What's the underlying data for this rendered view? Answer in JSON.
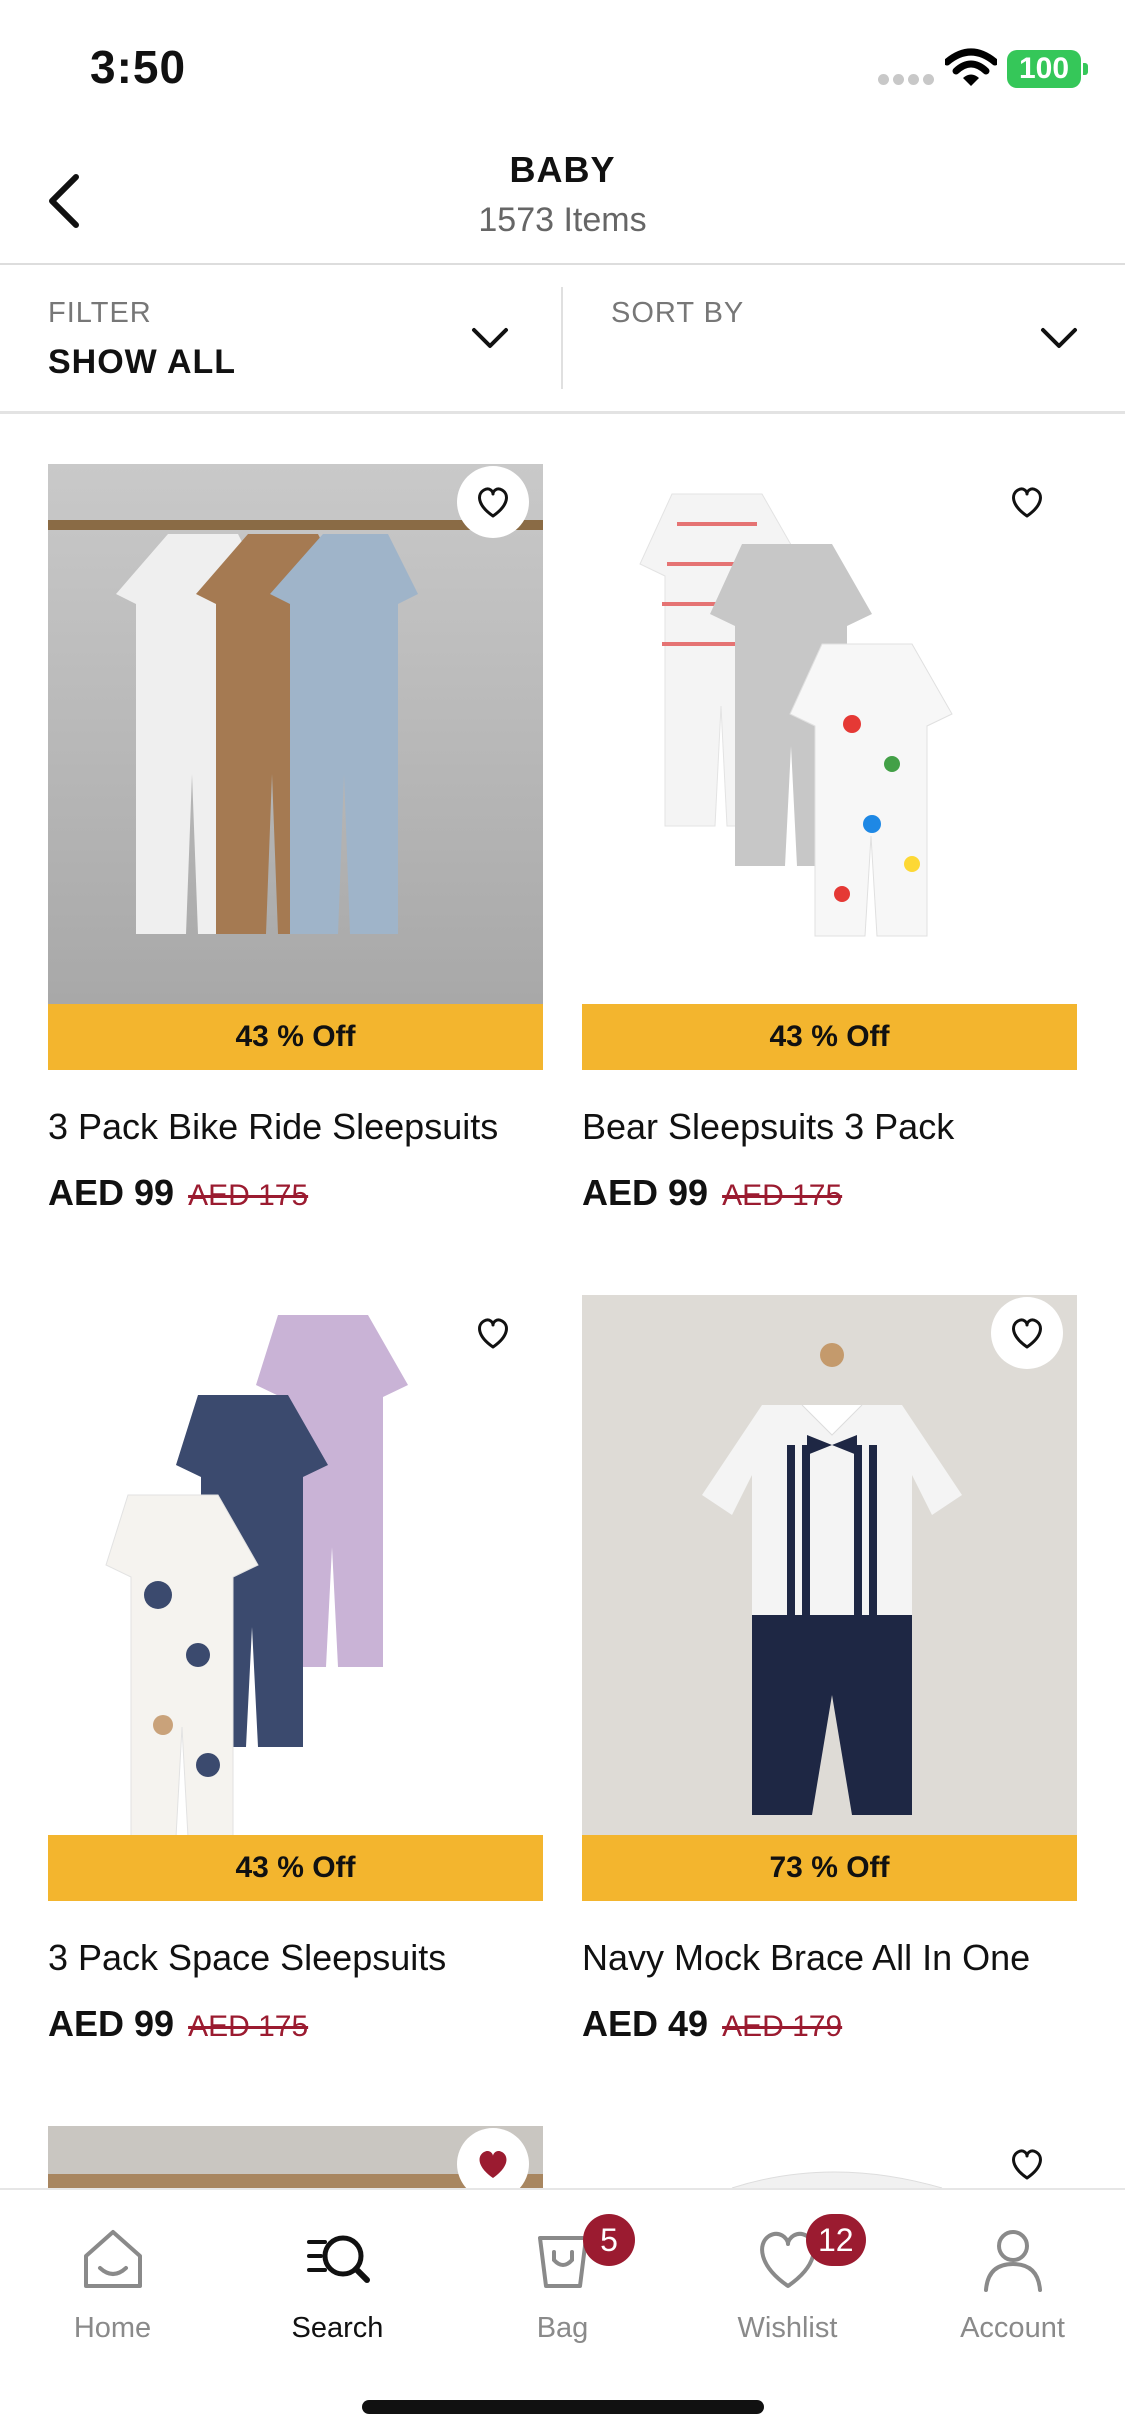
{
  "status_bar": {
    "time": "3:50",
    "battery": "100"
  },
  "header": {
    "title": "BABY",
    "item_count": "1573 Items"
  },
  "filter": {
    "label": "FILTER",
    "value": "SHOW ALL"
  },
  "sort": {
    "label": "SORT BY",
    "value": ""
  },
  "products": [
    {
      "name": "3 Pack Bike Ride Sleepsuits",
      "discount": "43 % Off",
      "price": "AED 99",
      "old_price": "AED 175",
      "wishlisted": false
    },
    {
      "name": "Bear Sleepsuits 3 Pack",
      "discount": "43 % Off",
      "price": "AED 99",
      "old_price": "AED 175",
      "wishlisted": false
    },
    {
      "name": "3 Pack Space Sleepsuits",
      "discount": "43 % Off",
      "price": "AED 99",
      "old_price": "AED 175",
      "wishlisted": false
    },
    {
      "name": "Navy Mock Brace All In One",
      "discount": "73 % Off",
      "price": "AED 49",
      "old_price": "AED 179",
      "wishlisted": false
    }
  ],
  "tabs": [
    {
      "label": "Home",
      "icon": "home-icon"
    },
    {
      "label": "Search",
      "icon": "search-icon"
    },
    {
      "label": "Bag",
      "icon": "bag-icon",
      "badge": "5"
    },
    {
      "label": "Wishlist",
      "icon": "heart-icon",
      "badge": "12"
    },
    {
      "label": "Account",
      "icon": "account-icon"
    }
  ],
  "colors": {
    "discount_band": "#f3b52e",
    "accent": "#9b1b30",
    "battery": "#35c759"
  }
}
